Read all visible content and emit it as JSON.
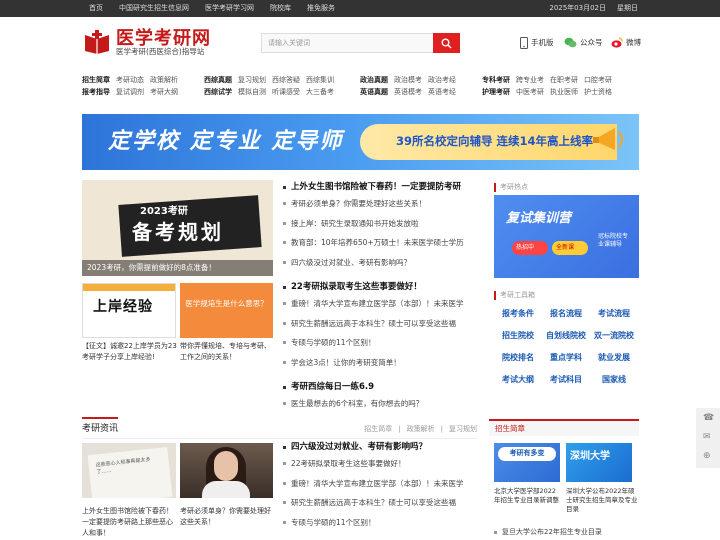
{
  "topbar": {
    "nav": [
      "首页",
      "中国研究生招生信息网",
      "医学考研学习网",
      "院校库",
      "推免服务"
    ],
    "date": "2025年03月02日",
    "weekday": "星期日"
  },
  "header": {
    "logo_title": "医学考研网",
    "logo_sub": "医学考研(西医综合)指导站",
    "search_placeholder": "请输入关键词",
    "links": [
      "手机版",
      "公众号",
      "微博"
    ]
  },
  "catnav": {
    "groups": [
      {
        "rows": [
          {
            "head": "招生简章",
            "items": [
              "考研动态",
              "政策解析"
            ]
          },
          {
            "head": "报考指导",
            "items": [
              "复试调剂",
              "考研大纲"
            ]
          }
        ]
      },
      {
        "rows": [
          {
            "head": "西综真题",
            "items": [
              "复习规划",
              "西综答疑",
              "西综集训"
            ]
          },
          {
            "head": "西综试学",
            "items": [
              "模拟自测",
              "听课感受",
              "大三备考"
            ]
          }
        ]
      },
      {
        "rows": [
          {
            "head": "政治真题",
            "items": [
              "政治模考",
              "政治考经"
            ]
          },
          {
            "head": "英语真题",
            "items": [
              "英语模考",
              "英语考经"
            ]
          }
        ]
      },
      {
        "rows": [
          {
            "head": "专科考研",
            "items": [
              "跨专业考",
              "在职考研",
              "口腔考研"
            ]
          },
          {
            "head": "护理考研",
            "items": [
              "中医考研",
              "执业医师",
              "护士资格"
            ]
          }
        ]
      }
    ]
  },
  "banner": {
    "main": "定学校 定专业 定导师",
    "sub": "39所名校定向辅导 连续14年高上线率"
  },
  "feature": {
    "img_line1": "2023考研",
    "img_line2": "备考规划",
    "caption": "2023考研，你需提前做好的8点准备！",
    "mini1_text": "上岸经验",
    "mini1_caption": "【征文】诚邀22上岸学员为23考研学子分享上岸经验!",
    "mini2_text": "医学规培生是什么意思？",
    "mini2_caption": "带你弄懂规培、专培与考研、工作之间的关系！"
  },
  "headlines": [
    {
      "title": "上外女生图书馆险被下春药！一定要提防考研",
      "items": [
        "考研必须单身？你需要处理好这些关系！",
        "接上岸：研究生录取通知书开始发放啦",
        "教育部：10年培养650+万硕士！未来医学硕士学历",
        "四六级没过对就业、考研有影响吗？"
      ]
    },
    {
      "title": "22考研拟录取考生这些事要做好！",
      "items": [
        "重磅！清华大学宣布建立医学部（本部）！未来医学",
        "研究生薪酬远远高于本科生？硕士可以享受这些福",
        "专硕与学硕的11个区别！",
        "学会这3点！让你的考研变简单！"
      ]
    },
    {
      "title": "考研西综每日一练6.9",
      "items": [
        "医生最想去的6个科室，有你想去的吗？"
      ]
    }
  ],
  "sidebar": {
    "hot_title": "考研热点",
    "ad_title": "复试集训营",
    "ad_badge1": "热招中",
    "ad_badge2": "全新课",
    "ad_note": "冠标院校专业课辅导",
    "tools_title": "考研工具箱",
    "tools": [
      "报考条件",
      "报名流程",
      "考试流程",
      "招生院校",
      "自划线院校",
      "双一流院校",
      "院校排名",
      "重点学科",
      "就业发展",
      "考试大纲",
      "考试科目",
      "国家线"
    ]
  },
  "news": {
    "title": "考研资讯",
    "links": [
      "招生简章",
      "政策解析",
      "复习规划"
    ],
    "thumb1_caption": "上外女生图书馆险被下春药！一定要提防考研路上那些恶心人和事！",
    "thumb1_ink": "这些恶心人和事真是太多了……",
    "thumb2_caption": "考研必须单身？你需要处理好这些关系！",
    "list": [
      {
        "head": true,
        "text": "四六级没过对就业、考研有影响吗？"
      },
      {
        "head": false,
        "text": "22考研拟录取考生这些事要做好！"
      },
      {
        "head": false,
        "text": "重磅！清华大学宣布建立医学部（本部）！未来医学"
      },
      {
        "head": false,
        "text": "研究生薪酬远远高于本科生？硕士可以享受这些福"
      },
      {
        "head": false,
        "text": "专硕与学硕的11个区别！"
      }
    ]
  },
  "admissions": {
    "title": "招生简章",
    "card1_text": "考研有多变",
    "card1_caption": "北京大学医学部2022年招生专业目录新调整",
    "card2_text": "深圳大学",
    "card2_caption": "深圳大学公布2022年硕士研究生招生简章及专业目录",
    "next_item": "复旦大学公布22年招生专业目录"
  },
  "float": [
    "☎",
    "✉",
    "⊕"
  ]
}
